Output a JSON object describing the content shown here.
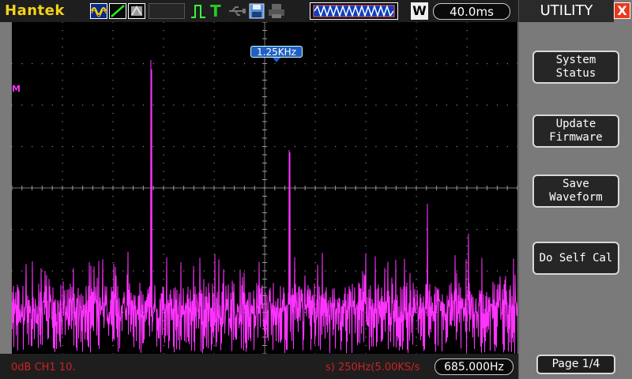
{
  "topbar": {
    "brand": "Hantek",
    "timebase": "40.0ms",
    "W_label": "W",
    "T_label": "T",
    "icons": [
      "waveform-mode-icon",
      "line-mode-icon",
      "persist-mode-icon",
      "trigger-edge-icon",
      "trigger-icon",
      "usb-icon",
      "save-disk-icon",
      "print-icon",
      "memory-waveform-icon"
    ]
  },
  "screen": {
    "channel_marker": "M",
    "freq_marker": "1.25KHz"
  },
  "bottombar": {
    "left_text": "0dB  CH1 10.",
    "mid_text": "s)  250Hz(5.00KS/s",
    "right_value": "685.000Hz"
  },
  "panel": {
    "title": "UTILITY",
    "close_label": "X",
    "buttons": [
      {
        "label": "System\nStatus"
      },
      {
        "label": "Update\nFirmware"
      },
      {
        "label": "Save\nWaveform"
      },
      {
        "label": "Do Self Cal"
      }
    ],
    "page_label": "Page 1/4"
  },
  "colors": {
    "trace": "#ff33ff",
    "brand": "#f3d21a",
    "accent_blue": "#2160c4",
    "close_red": "#e8391c",
    "status_red": "#cc2222"
  }
}
